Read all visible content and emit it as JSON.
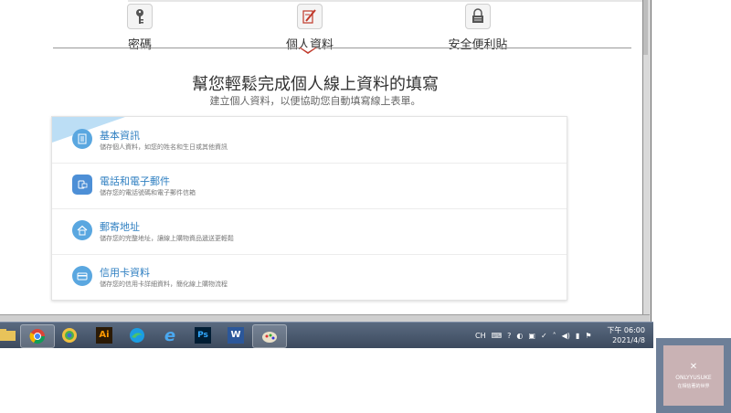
{
  "tabs": [
    {
      "label": "密碼",
      "icon": "key-icon"
    },
    {
      "label": "個人資料",
      "icon": "edit-pen-icon"
    },
    {
      "label": "安全便利貼",
      "icon": "lock-icon"
    }
  ],
  "hero": {
    "title": "幫您輕鬆完成個人線上資料的填寫",
    "subtitle": "建立個人資料，以便協助您自動填寫線上表單。"
  },
  "rows": [
    {
      "title": "基本資訊",
      "desc": "儲存個人資料，如您的姓名和生日或其他資訊",
      "icon": "id-card-icon"
    },
    {
      "title": "電話和電子郵件",
      "desc": "儲存您的電話號碼和電子郵件信箱",
      "icon": "phone-mail-icon"
    },
    {
      "title": "郵寄地址",
      "desc": "儲存您的完整地址，讓線上購物資品遞送更輕鬆",
      "icon": "home-icon"
    },
    {
      "title": "信用卡資料",
      "desc": "儲存您的信用卡詳細資料，簡化線上購物流程",
      "icon": "credit-card-icon"
    }
  ],
  "taskbar": {
    "apps": [
      "explorer-icon",
      "chrome-icon",
      "color-picker-icon",
      "illustrator-icon",
      "edge-icon",
      "ie-icon",
      "photoshop-icon",
      "word-icon",
      "paint-icon"
    ],
    "ai_label": "Ai",
    "ps_label": "Ps",
    "word_label": "W",
    "lang": "CH",
    "time_ampm": "下午 06:00",
    "date": "2021/4/8"
  },
  "watermark": {
    "x": "✕",
    "line1": "ONLYYUSUKE",
    "line2": "在相信著的世界"
  },
  "colors": {
    "accent": "#2f7fc1",
    "caret": "#c0392b",
    "taskbar": "#46556a"
  }
}
